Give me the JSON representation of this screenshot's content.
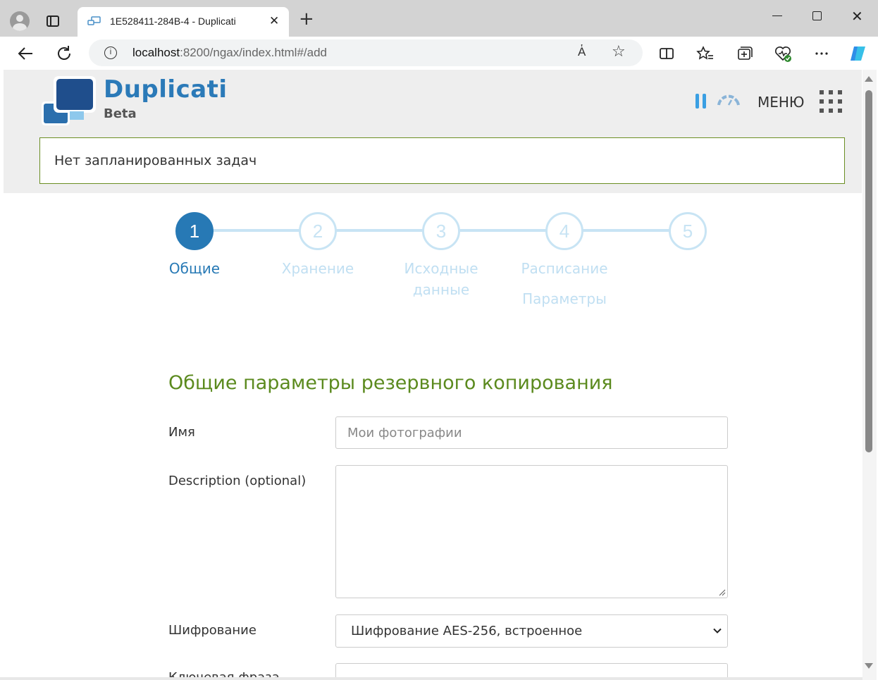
{
  "browser": {
    "tab_title": "1E528411-284B-4 - Duplicati",
    "tab_close": "✕",
    "new_tab": "+",
    "address_host": "localhost",
    "address_rest": ":8200/ngax/index.html#/add",
    "read_aloud": "A҅",
    "favorite": "☆",
    "close_window": "✕"
  },
  "header": {
    "brand": "Duplicati",
    "brand_sub": "Beta",
    "menu_label": "МЕНЮ",
    "accent_color": "#2b7ab8",
    "pause_color": "#3a9fe3"
  },
  "notice": {
    "text": "Нет запланированных задач",
    "border_color": "#6b8e23"
  },
  "steps": [
    {
      "number": "1",
      "label": "Общие",
      "active": true
    },
    {
      "number": "2",
      "label": "Хранение",
      "active": false
    },
    {
      "number": "3",
      "label_line1": "Исходные",
      "label_line2": "данные",
      "active": false
    },
    {
      "number": "4",
      "label": "Расписание",
      "active": false
    },
    {
      "number": "5",
      "label": "Параметры",
      "active": false
    }
  ],
  "form": {
    "section_title": "Общие параметры резервного копирования",
    "name_label": "Имя",
    "name_placeholder": "Мои фотографии",
    "name_value": "",
    "description_label": "Description (optional)",
    "description_value": "",
    "encryption_label": "Шифрование",
    "encryption_selected": "Шифрование AES-256, встроенное",
    "passphrase_label": "Ключевая фраза"
  }
}
